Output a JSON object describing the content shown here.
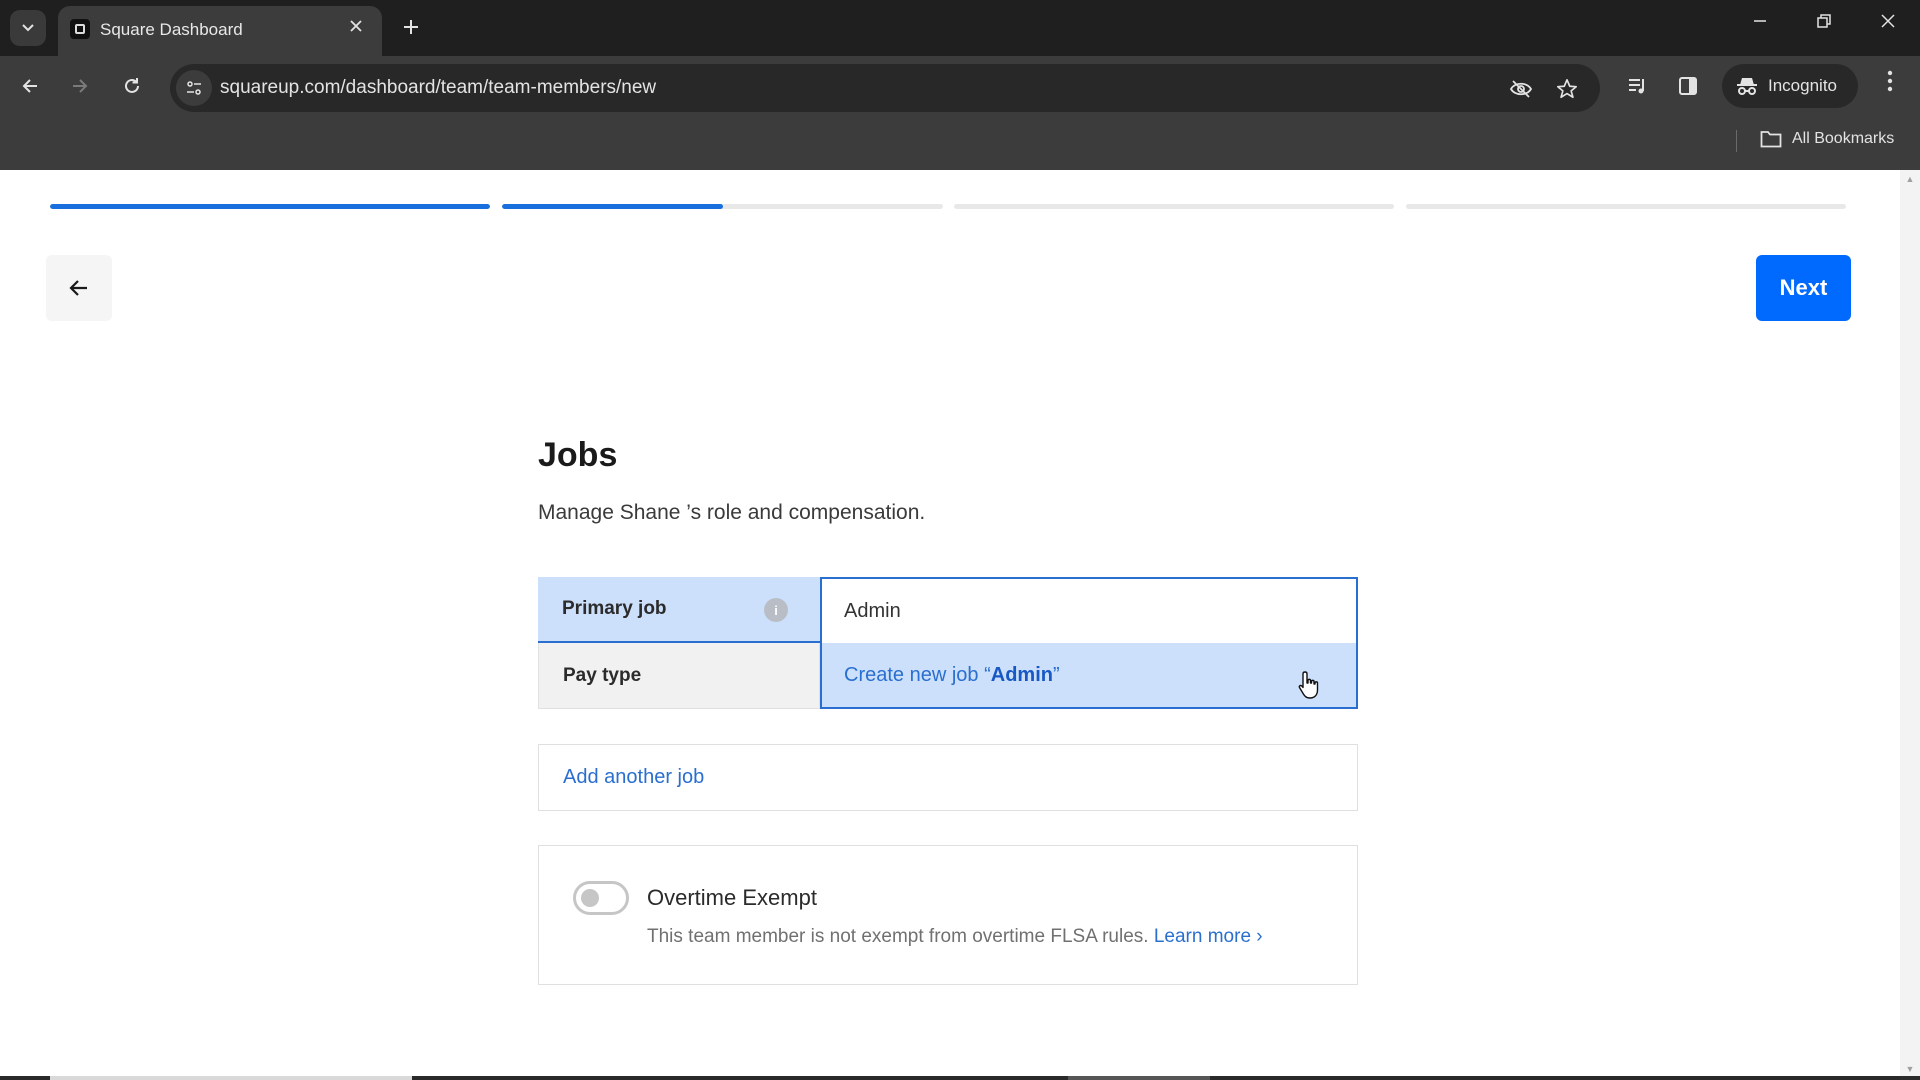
{
  "browser": {
    "tab_title": "Square Dashboard",
    "url": "squareup.com/dashboard/team/team-members/new",
    "incognito_label": "Incognito",
    "all_bookmarks_label": "All Bookmarks",
    "icons": {
      "tab_list": "chevron-down-icon",
      "tab_close": "close-icon",
      "new_tab": "plus-icon",
      "minimize": "minimize-icon",
      "restore": "restore-icon",
      "close_window": "close-icon",
      "back": "arrow-left-icon",
      "forward": "arrow-right-icon",
      "reload": "reload-icon",
      "site_info": "tune-icon",
      "eye_off": "eye-off-icon",
      "bookmark_star": "star-icon",
      "media": "media-queue-icon",
      "side_panel": "side-panel-icon",
      "incognito": "incognito-icon",
      "menu": "more-vertical-icon",
      "folder": "folder-icon"
    }
  },
  "progress": {
    "steps": [
      {
        "filled": 1.0
      },
      {
        "filled": 0.5
      },
      {
        "filled": 0.0
      },
      {
        "filled": 0.0
      }
    ],
    "accent_color": "#1a6fde"
  },
  "nav": {
    "next_label": "Next",
    "next_color": "#006aff"
  },
  "jobs": {
    "title": "Jobs",
    "subtitle": "Manage Shane ’s role and compensation.",
    "primary_job_label": "Primary job",
    "pay_type_label": "Pay type",
    "primary_job_value": "Admin",
    "create_option_prefix": "Create new job “",
    "create_option_name": "Admin",
    "create_option_suffix": "”",
    "info_icon_glyph": "i",
    "add_another_job_label": "Add another job"
  },
  "overtime": {
    "title": "Overtime Exempt",
    "enabled": false,
    "description": "This team member is not exempt from overtime FLSA rules. ",
    "learn_more_label": "Learn more",
    "learn_more_chevron": "›"
  }
}
